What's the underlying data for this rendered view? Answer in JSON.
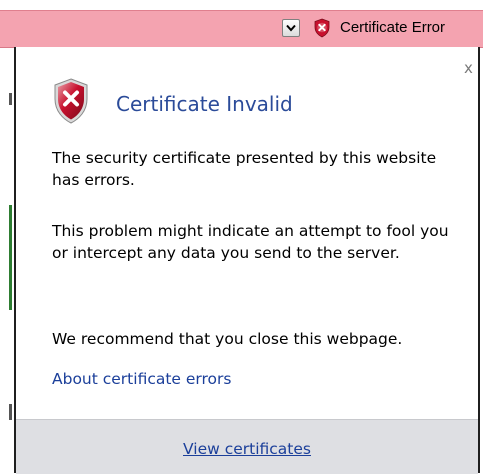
{
  "toolbar": {
    "status_label": "Certificate Error",
    "dropdown_icon": "chevron-down-icon",
    "status_icon": "shield-error-icon"
  },
  "popup": {
    "close_label": "x",
    "title": "Certificate Invalid",
    "icon": "shield-error-icon",
    "paragraphs": [
      "The security certificate presented by this website has errors.",
      "This problem might indicate an attempt to fool you or intercept any data you send to the server.",
      "We recommend that you close this webpage."
    ],
    "link_about": "About certificate errors",
    "link_view": "View certificates"
  },
  "colors": {
    "toolbar_bg": "#f4a3b0",
    "title": "#2b4b99",
    "link": "#1b3f9a",
    "footer_bg": "#dedfe3",
    "shield_red": "#c8102e"
  }
}
